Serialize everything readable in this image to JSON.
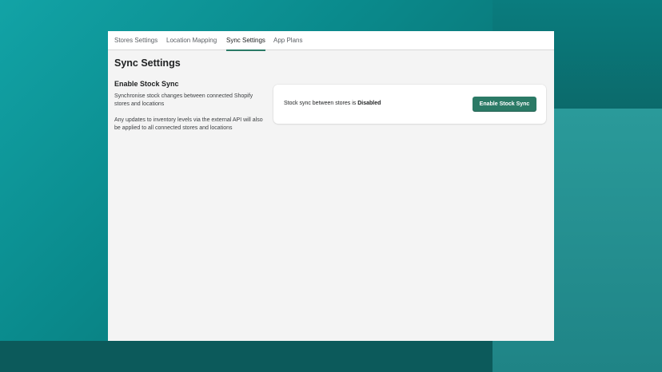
{
  "tabs": [
    {
      "label": "Stores Settings"
    },
    {
      "label": "Location Mapping"
    },
    {
      "label": "Sync Settings",
      "active": true
    },
    {
      "label": "App Plans"
    }
  ],
  "page": {
    "title": "Sync Settings"
  },
  "section": {
    "title": "Enable Stock Sync",
    "description_1": "Synchronise stock changes between connected Shopify stores and locations",
    "description_2": "Any updates to inventory levels via the external API will also be applied to all connected stores and locations"
  },
  "card": {
    "status_prefix": "Stock sync between stores is ",
    "status_value": "Disabled",
    "button_label": "Enable Stock Sync"
  },
  "colors": {
    "accent": "#2b7a66",
    "page_background": "#f4f4f4",
    "desktop_teal": "#0a8a8c"
  }
}
